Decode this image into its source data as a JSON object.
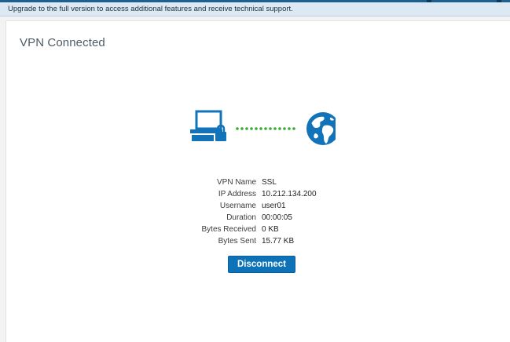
{
  "banner": {
    "text": "Upgrade to the full version to access additional features and receive technical support."
  },
  "panel": {
    "title": "VPN Connected"
  },
  "icons": {
    "computer": "computer-lock-icon",
    "connection": "dotted-connection-icon",
    "globe": "globe-icon"
  },
  "colors": {
    "accent": "#0d72b8",
    "connection": "#3aaa35",
    "icon": "#1373b8"
  },
  "vpn_info": [
    {
      "label": "VPN Name",
      "value": "SSL"
    },
    {
      "label": "IP Address",
      "value": "10.212.134.200"
    },
    {
      "label": "Username",
      "value": "user01"
    },
    {
      "label": "Duration",
      "value": "00:00:05"
    },
    {
      "label": "Bytes Received",
      "value": "0 KB"
    },
    {
      "label": "Bytes Sent",
      "value": "15.77 KB"
    }
  ],
  "actions": {
    "disconnect_label": "Disconnect"
  }
}
